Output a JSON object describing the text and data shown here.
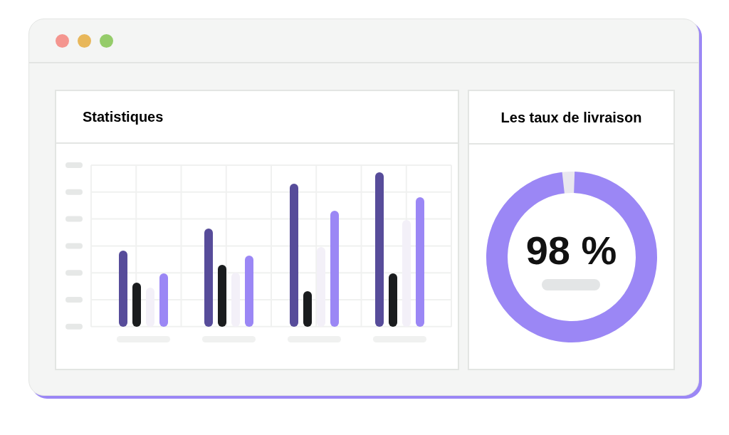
{
  "window": {
    "controls": [
      {
        "color": "#f4958f"
      },
      {
        "color": "#e8b75a"
      },
      {
        "color": "#95cc6a"
      }
    ]
  },
  "statistics": {
    "title": "Statistiques"
  },
  "delivery": {
    "title": "Les taux de livraison",
    "reading": "98 %",
    "level": 0.98
  }
}
